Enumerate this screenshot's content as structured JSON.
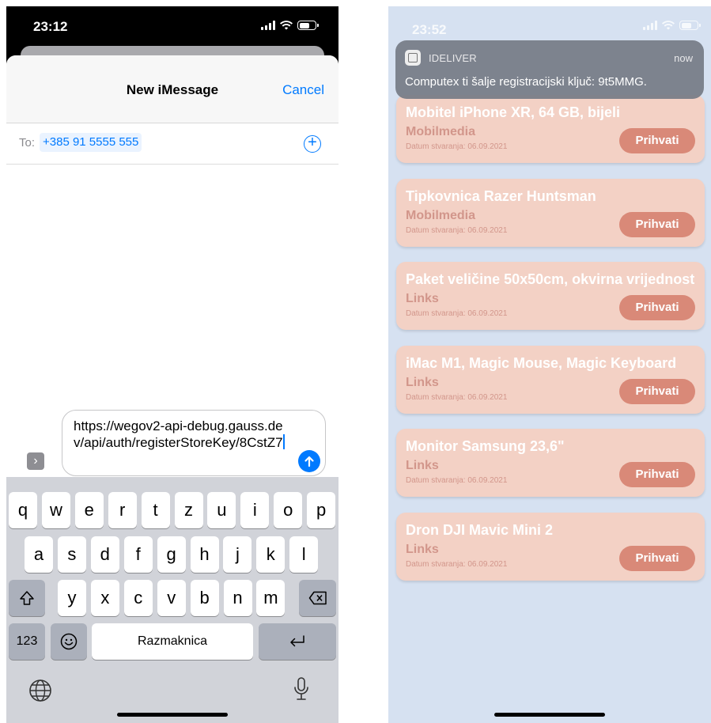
{
  "left": {
    "status_time": "23:12",
    "nav": {
      "title": "New iMessage",
      "cancel": "Cancel"
    },
    "to": {
      "label": "To:",
      "recipient": "+385 91 5555 555",
      "add_icon": "plus-circle-icon"
    },
    "message": {
      "text": "https://wegov2-api-debug.gauss.dev/api/auth/registerStoreKey/8CstZ7"
    },
    "keyboard": {
      "row1": [
        "q",
        "w",
        "e",
        "r",
        "t",
        "z",
        "u",
        "i",
        "o",
        "p"
      ],
      "row2": [
        "a",
        "s",
        "d",
        "f",
        "g",
        "h",
        "j",
        "k",
        "l"
      ],
      "row3": [
        "y",
        "x",
        "c",
        "v",
        "b",
        "n",
        "m"
      ],
      "numbers": "123",
      "space": "Razmaknica"
    }
  },
  "right": {
    "status_time": "23:52",
    "notification": {
      "app": "IDELIVER",
      "time": "now",
      "body": "Computex ti šalje registracijski ključ: 9t5MMG."
    },
    "cards": [
      {
        "title": "Mobitel iPhone XR, 64 GB, bijeli",
        "store": "Mobilmedia",
        "date": "Datum stvaranja: 06.09.2021",
        "action": "Prihvati"
      },
      {
        "title": "Tipkovnica Razer Huntsman",
        "store": "Mobilmedia",
        "date": "Datum stvaranja: 06.09.2021",
        "action": "Prihvati"
      },
      {
        "title": "Paket veličine 50x50cm, okvirna vrijednost",
        "store": "Links",
        "date": "Datum stvaranja: 06.09.2021",
        "action": "Prihvati"
      },
      {
        "title": "iMac M1, Magic Mouse, Magic Keyboard",
        "store": "Links",
        "date": "Datum stvaranja: 06.09.2021",
        "action": "Prihvati"
      },
      {
        "title": "Monitor Samsung 23,6\"",
        "store": "Links",
        "date": "Datum stvaranja: 06.09.2021",
        "action": "Prihvati"
      },
      {
        "title": "Dron DJI Mavic Mini 2",
        "store": "Links",
        "date": "Datum stvaranja: 06.09.2021",
        "action": "Prihvati"
      }
    ]
  }
}
